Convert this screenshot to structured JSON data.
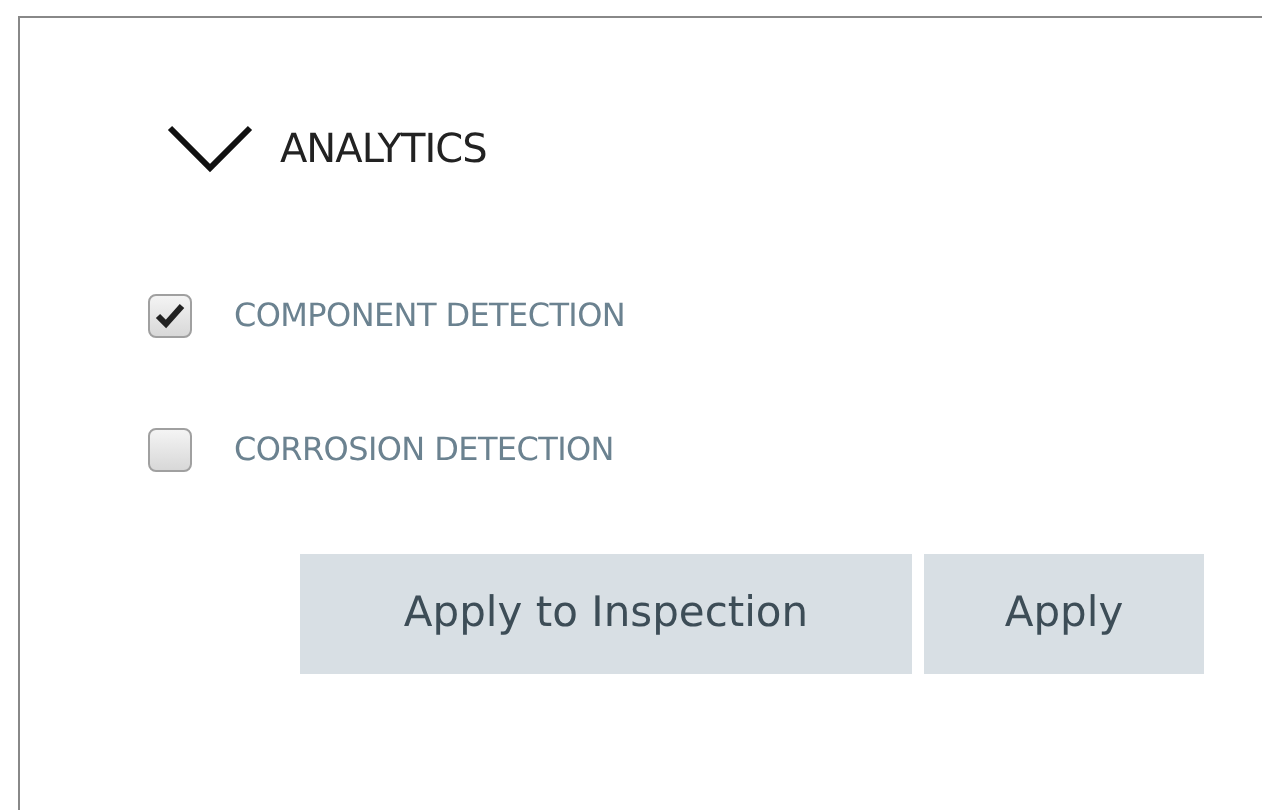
{
  "section": {
    "title": "ANALYTICS",
    "expanded": true
  },
  "options": [
    {
      "label": "COMPONENT DETECTION",
      "checked": true
    },
    {
      "label": "CORROSION DETECTION",
      "checked": false
    }
  ],
  "buttons": [
    "Apply to Inspection",
    "Apply"
  ]
}
